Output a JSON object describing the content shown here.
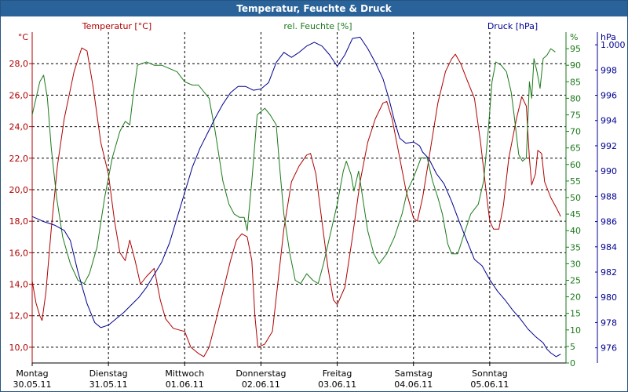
{
  "window": {
    "title": "Temperatur, Feuchte & Druck"
  },
  "chart_data": {
    "type": "line",
    "title": "Temperatur, Feuchte & Druck",
    "grid": true,
    "x_labels": [
      {
        "day": "Montag",
        "date": "30.05.11"
      },
      {
        "day": "Dienstag",
        "date": "31.05.11"
      },
      {
        "day": "Mittwoch",
        "date": "01.06.11"
      },
      {
        "day": "Donnerstag",
        "date": "02.06.11"
      },
      {
        "day": "Freitag",
        "date": "03.06.11"
      },
      {
        "day": "Samstag",
        "date": "04.06.11"
      },
      {
        "day": "Sonntag",
        "date": "05.06.11"
      }
    ],
    "x_unit_note": "x = days after start of 30.05.11",
    "xlim": [
      0,
      7
    ],
    "axes": {
      "temperature": {
        "label": "Temperatur [°C]",
        "unit": "°C",
        "side": "left",
        "color": "#b00000",
        "ticks": [
          "28,0",
          "26,0",
          "24,0",
          "22,0",
          "20,0",
          "18,0",
          "16,0",
          "14,0",
          "12,0",
          "10,0"
        ],
        "tick_values": [
          28,
          26,
          24,
          22,
          20,
          18,
          16,
          14,
          12,
          10
        ],
        "ylim": [
          9,
          30
        ]
      },
      "humidity": {
        "label": "rel. Feuchte [%]",
        "unit": "%",
        "side": "right-inner",
        "color": "#1a7a1a",
        "ticks": [
          "95",
          "90",
          "85",
          "80",
          "75",
          "70",
          "65",
          "60",
          "55",
          "50",
          "45",
          "40",
          "35",
          "30",
          "25",
          "20",
          "15",
          "10",
          "5",
          "0"
        ],
        "tick_values": [
          95,
          90,
          85,
          80,
          75,
          70,
          65,
          60,
          55,
          50,
          45,
          40,
          35,
          30,
          25,
          20,
          15,
          10,
          5,
          0
        ],
        "ylim": [
          0,
          100
        ]
      },
      "pressure": {
        "label": "Druck [hPa]",
        "unit": "hPa",
        "side": "right-outer",
        "color": "#000090",
        "ticks": [
          "1.000",
          "998",
          "996",
          "994",
          "992",
          "990",
          "988",
          "986",
          "984",
          "982",
          "980",
          "978",
          "976"
        ],
        "tick_values": [
          1000,
          998,
          996,
          994,
          992,
          990,
          988,
          986,
          984,
          982,
          980,
          978,
          976
        ],
        "ylim": [
          974.8,
          1001.0
        ]
      }
    },
    "series": [
      {
        "name": "Temperatur [°C]",
        "axis": "temperature",
        "color": "#b00000",
        "points": [
          [
            0.0,
            14.2
          ],
          [
            0.05,
            12.8
          ],
          [
            0.1,
            12.0
          ],
          [
            0.13,
            11.7
          ],
          [
            0.18,
            13.5
          ],
          [
            0.25,
            17.5
          ],
          [
            0.33,
            21.5
          ],
          [
            0.42,
            24.5
          ],
          [
            0.55,
            27.5
          ],
          [
            0.65,
            29.0
          ],
          [
            0.72,
            28.8
          ],
          [
            0.8,
            26.5
          ],
          [
            0.9,
            23.0
          ],
          [
            1.0,
            21.0
          ],
          [
            1.08,
            18.0
          ],
          [
            1.15,
            16.0
          ],
          [
            1.22,
            15.5
          ],
          [
            1.28,
            16.8
          ],
          [
            1.35,
            15.5
          ],
          [
            1.42,
            14.0
          ],
          [
            1.5,
            14.5
          ],
          [
            1.6,
            15.0
          ],
          [
            1.68,
            13.0
          ],
          [
            1.75,
            11.8
          ],
          [
            1.85,
            11.2
          ],
          [
            2.0,
            11.0
          ],
          [
            2.08,
            10.0
          ],
          [
            2.18,
            9.6
          ],
          [
            2.25,
            9.4
          ],
          [
            2.32,
            10.0
          ],
          [
            2.4,
            11.5
          ],
          [
            2.5,
            13.5
          ],
          [
            2.6,
            15.5
          ],
          [
            2.68,
            16.8
          ],
          [
            2.75,
            17.2
          ],
          [
            2.82,
            17.0
          ],
          [
            2.88,
            15.5
          ],
          [
            2.92,
            12.0
          ],
          [
            2.96,
            10.0
          ],
          [
            3.05,
            10.2
          ],
          [
            3.15,
            11.0
          ],
          [
            3.22,
            14.0
          ],
          [
            3.3,
            17.5
          ],
          [
            3.4,
            20.5
          ],
          [
            3.5,
            21.5
          ],
          [
            3.6,
            22.2
          ],
          [
            3.65,
            22.3
          ],
          [
            3.72,
            21.0
          ],
          [
            3.8,
            18.0
          ],
          [
            3.88,
            15.0
          ],
          [
            3.95,
            13.0
          ],
          [
            4.0,
            12.7
          ],
          [
            4.1,
            13.8
          ],
          [
            4.2,
            17.0
          ],
          [
            4.3,
            20.5
          ],
          [
            4.4,
            23.0
          ],
          [
            4.5,
            24.5
          ],
          [
            4.6,
            25.5
          ],
          [
            4.65,
            25.6
          ],
          [
            4.72,
            24.5
          ],
          [
            4.8,
            22.5
          ],
          [
            4.9,
            20.0
          ],
          [
            5.0,
            18.2
          ],
          [
            5.05,
            18.0
          ],
          [
            5.12,
            19.5
          ],
          [
            5.22,
            22.5
          ],
          [
            5.32,
            25.5
          ],
          [
            5.42,
            27.5
          ],
          [
            5.5,
            28.3
          ],
          [
            5.55,
            28.6
          ],
          [
            5.62,
            28.0
          ],
          [
            5.7,
            27.0
          ],
          [
            5.8,
            25.8
          ],
          [
            5.88,
            23.0
          ],
          [
            5.95,
            20.0
          ],
          [
            6.0,
            18.0
          ],
          [
            6.05,
            17.5
          ],
          [
            6.12,
            17.5
          ],
          [
            6.18,
            19.0
          ],
          [
            6.25,
            22.0
          ],
          [
            6.35,
            24.5
          ],
          [
            6.42,
            25.9
          ],
          [
            6.48,
            25.3
          ],
          [
            6.52,
            22.0
          ],
          [
            6.55,
            20.3
          ],
          [
            6.6,
            21.0
          ],
          [
            6.63,
            22.5
          ],
          [
            6.68,
            22.3
          ],
          [
            6.72,
            20.5
          ],
          [
            6.8,
            19.5
          ],
          [
            6.88,
            18.8
          ],
          [
            6.93,
            18.3
          ]
        ]
      },
      {
        "name": "rel. Feuchte [%]",
        "axis": "humidity",
        "color": "#1a7a1a",
        "points": [
          [
            0.0,
            75
          ],
          [
            0.05,
            80
          ],
          [
            0.1,
            85
          ],
          [
            0.15,
            87
          ],
          [
            0.2,
            80
          ],
          [
            0.25,
            65
          ],
          [
            0.32,
            50
          ],
          [
            0.4,
            38
          ],
          [
            0.5,
            30
          ],
          [
            0.6,
            25
          ],
          [
            0.68,
            24
          ],
          [
            0.75,
            27
          ],
          [
            0.85,
            35
          ],
          [
            0.95,
            50
          ],
          [
            1.05,
            62
          ],
          [
            1.15,
            70
          ],
          [
            1.22,
            73
          ],
          [
            1.28,
            72
          ],
          [
            1.32,
            80
          ],
          [
            1.38,
            90
          ],
          [
            1.5,
            91
          ],
          [
            1.6,
            90
          ],
          [
            1.7,
            90
          ],
          [
            1.8,
            89
          ],
          [
            1.9,
            88
          ],
          [
            2.0,
            85
          ],
          [
            2.1,
            84
          ],
          [
            2.18,
            84
          ],
          [
            2.25,
            82
          ],
          [
            2.32,
            80
          ],
          [
            2.4,
            70
          ],
          [
            2.5,
            55
          ],
          [
            2.58,
            48
          ],
          [
            2.65,
            45
          ],
          [
            2.72,
            44
          ],
          [
            2.78,
            44
          ],
          [
            2.82,
            40
          ],
          [
            2.88,
            55
          ],
          [
            2.95,
            75
          ],
          [
            3.05,
            77
          ],
          [
            3.12,
            75
          ],
          [
            3.2,
            72
          ],
          [
            3.25,
            58
          ],
          [
            3.3,
            45
          ],
          [
            3.38,
            33
          ],
          [
            3.45,
            25
          ],
          [
            3.52,
            24
          ],
          [
            3.6,
            27
          ],
          [
            3.68,
            25
          ],
          [
            3.75,
            24
          ],
          [
            3.82,
            30
          ],
          [
            3.92,
            40
          ],
          [
            4.0,
            48
          ],
          [
            4.08,
            58
          ],
          [
            4.12,
            61
          ],
          [
            4.18,
            57
          ],
          [
            4.22,
            52
          ],
          [
            4.28,
            58
          ],
          [
            4.32,
            52
          ],
          [
            4.4,
            40
          ],
          [
            4.48,
            33
          ],
          [
            4.55,
            30
          ],
          [
            4.65,
            33
          ],
          [
            4.75,
            38
          ],
          [
            4.85,
            45
          ],
          [
            4.92,
            52
          ],
          [
            5.0,
            56
          ],
          [
            5.1,
            62
          ],
          [
            5.18,
            62
          ],
          [
            5.25,
            55
          ],
          [
            5.32,
            50
          ],
          [
            5.38,
            45
          ],
          [
            5.45,
            36
          ],
          [
            5.5,
            33
          ],
          [
            5.58,
            33
          ],
          [
            5.65,
            38
          ],
          [
            5.75,
            45
          ],
          [
            5.85,
            48
          ],
          [
            5.92,
            55
          ],
          [
            5.98,
            70
          ],
          [
            6.03,
            85
          ],
          [
            6.08,
            91
          ],
          [
            6.15,
            90
          ],
          [
            6.22,
            88
          ],
          [
            6.28,
            82
          ],
          [
            6.32,
            75
          ],
          [
            6.38,
            63
          ],
          [
            6.43,
            61
          ],
          [
            6.48,
            62
          ],
          [
            6.52,
            85
          ],
          [
            6.55,
            80
          ],
          [
            6.58,
            92
          ],
          [
            6.62,
            88
          ],
          [
            6.66,
            83
          ],
          [
            6.7,
            92
          ],
          [
            6.75,
            93
          ],
          [
            6.8,
            95
          ],
          [
            6.86,
            94
          ]
        ]
      },
      {
        "name": "Druck [hPa]",
        "axis": "pressure",
        "color": "#000090",
        "points": [
          [
            0.0,
            986.4
          ],
          [
            0.15,
            986.0
          ],
          [
            0.3,
            985.7
          ],
          [
            0.42,
            985.3
          ],
          [
            0.5,
            984.5
          ],
          [
            0.6,
            982.0
          ],
          [
            0.72,
            979.5
          ],
          [
            0.82,
            978.0
          ],
          [
            0.9,
            977.6
          ],
          [
            1.0,
            977.8
          ],
          [
            1.1,
            978.3
          ],
          [
            1.2,
            978.8
          ],
          [
            1.3,
            979.4
          ],
          [
            1.4,
            980.0
          ],
          [
            1.5,
            980.8
          ],
          [
            1.6,
            981.8
          ],
          [
            1.7,
            982.8
          ],
          [
            1.8,
            984.3
          ],
          [
            1.9,
            986.3
          ],
          [
            2.0,
            988.3
          ],
          [
            2.1,
            990.3
          ],
          [
            2.2,
            991.8
          ],
          [
            2.3,
            993.0
          ],
          [
            2.4,
            994.2
          ],
          [
            2.5,
            995.3
          ],
          [
            2.6,
            996.2
          ],
          [
            2.7,
            996.7
          ],
          [
            2.8,
            996.7
          ],
          [
            2.9,
            996.4
          ],
          [
            3.0,
            996.5
          ],
          [
            3.1,
            997.0
          ],
          [
            3.2,
            998.6
          ],
          [
            3.3,
            999.4
          ],
          [
            3.4,
            999.0
          ],
          [
            3.5,
            999.4
          ],
          [
            3.6,
            999.9
          ],
          [
            3.7,
            1000.2
          ],
          [
            3.8,
            999.9
          ],
          [
            3.9,
            999.2
          ],
          [
            4.0,
            998.3
          ],
          [
            4.1,
            999.2
          ],
          [
            4.2,
            1000.5
          ],
          [
            4.3,
            1000.6
          ],
          [
            4.4,
            999.7
          ],
          [
            4.5,
            998.6
          ],
          [
            4.6,
            997.3
          ],
          [
            4.68,
            995.7
          ],
          [
            4.75,
            994.0
          ],
          [
            4.82,
            992.6
          ],
          [
            4.9,
            992.2
          ],
          [
            5.0,
            992.3
          ],
          [
            5.08,
            992.0
          ],
          [
            5.12,
            991.5
          ],
          [
            5.2,
            991.0
          ],
          [
            5.3,
            989.8
          ],
          [
            5.4,
            989.0
          ],
          [
            5.5,
            987.6
          ],
          [
            5.6,
            986.0
          ],
          [
            5.7,
            984.5
          ],
          [
            5.8,
            983.0
          ],
          [
            5.9,
            982.5
          ],
          [
            6.0,
            981.4
          ],
          [
            6.1,
            980.5
          ],
          [
            6.2,
            979.8
          ],
          [
            6.3,
            979.0
          ],
          [
            6.4,
            978.3
          ],
          [
            6.5,
            977.5
          ],
          [
            6.6,
            976.9
          ],
          [
            6.7,
            976.4
          ],
          [
            6.75,
            975.9
          ],
          [
            6.8,
            975.6
          ],
          [
            6.87,
            975.3
          ],
          [
            6.93,
            975.5
          ]
        ]
      }
    ]
  }
}
